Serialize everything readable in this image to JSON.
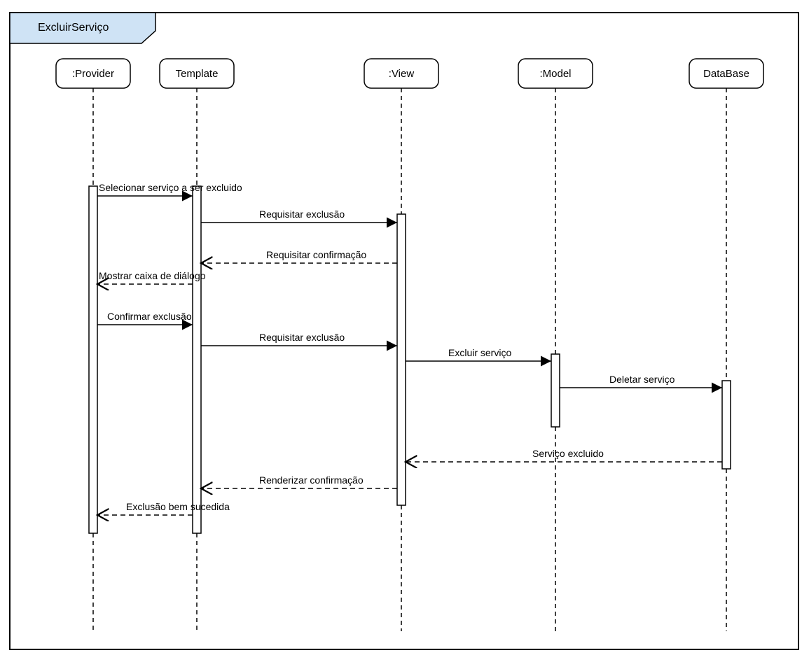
{
  "frame": {
    "title": "ExcluirServiço"
  },
  "lifelines": {
    "provider": ":Provider",
    "template": "Template",
    "view": ":View",
    "model": ":Model",
    "database": "DataBase"
  },
  "messages": {
    "m1": "Selecionar serviço a ser excluido",
    "m2": "Requisitar exclusão",
    "m3": "Requisitar confirmação",
    "m4": "Mostrar caixa de diálogo",
    "m5": "Confirmar exclusão",
    "m6": "Requisitar exclusão",
    "m7": "Excluir serviço",
    "m8": "Deletar serviço",
    "m9": "Serviço excluido",
    "m10": "Renderizar confirmação",
    "m11": "Exclusão bem sucedida"
  },
  "chart_data": {
    "type": "sequence_diagram",
    "frame_label": "ExcluirServiço",
    "lifelines": [
      ":Provider",
      "Template",
      ":View",
      ":Model",
      "DataBase"
    ],
    "messages": [
      {
        "from": ":Provider",
        "to": "Template",
        "label": "Selecionar serviço a ser excluido",
        "type": "sync"
      },
      {
        "from": "Template",
        "to": ":View",
        "label": "Requisitar exclusão",
        "type": "sync"
      },
      {
        "from": ":View",
        "to": "Template",
        "label": "Requisitar confirmação",
        "type": "return"
      },
      {
        "from": "Template",
        "to": ":Provider",
        "label": "Mostrar caixa de diálogo",
        "type": "return"
      },
      {
        "from": ":Provider",
        "to": "Template",
        "label": "Confirmar exclusão",
        "type": "sync"
      },
      {
        "from": "Template",
        "to": ":View",
        "label": "Requisitar exclusão",
        "type": "sync"
      },
      {
        "from": ":View",
        "to": ":Model",
        "label": "Excluir serviço",
        "type": "sync"
      },
      {
        "from": ":Model",
        "to": "DataBase",
        "label": "Deletar serviço",
        "type": "sync"
      },
      {
        "from": "DataBase",
        "to": ":View",
        "label": "Serviço excluido",
        "type": "return"
      },
      {
        "from": ":View",
        "to": "Template",
        "label": "Renderizar confirmação",
        "type": "return"
      },
      {
        "from": "Template",
        "to": ":Provider",
        "label": "Exclusão bem sucedida",
        "type": "return"
      }
    ]
  }
}
